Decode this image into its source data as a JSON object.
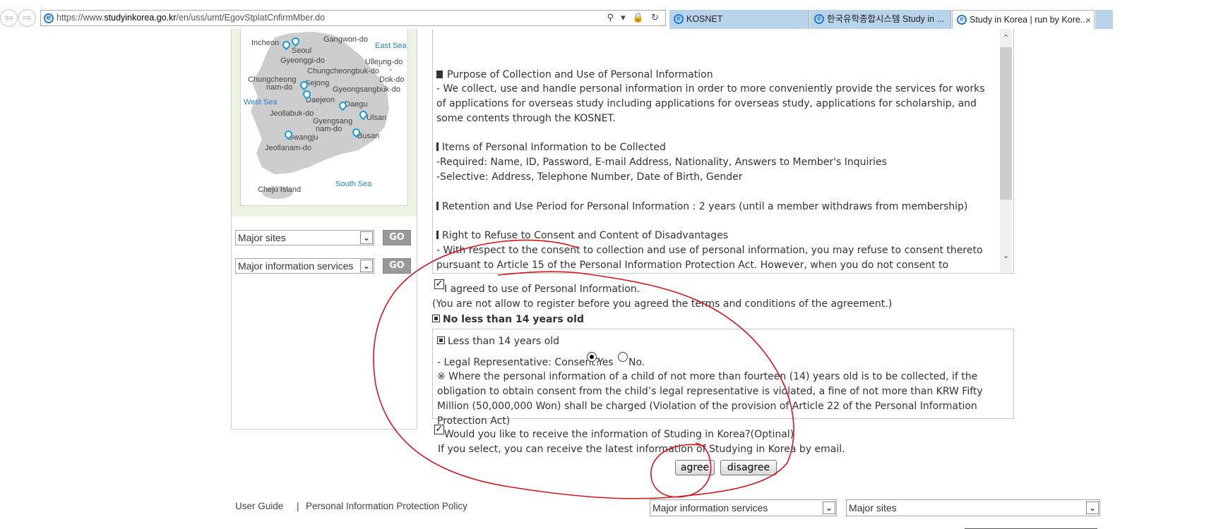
{
  "browser": {
    "url_prefix": "https://www.",
    "url_host": "studyinkorea.go.kr",
    "url_path": "/en/uss/umt/EgovStplatCnfirmMber.do",
    "address_tools": "⚲ ▾ 🔒 ↻",
    "tabs": [
      {
        "label": "KOSNET"
      },
      {
        "label": "한국유학종합시스템 Study in ..."
      },
      {
        "label": "Study in Korea | run by Kore..."
      }
    ],
    "tab_close": "×"
  },
  "map": {
    "labels": {
      "incheon": "Incheon",
      "seoul": "Seoul",
      "gangwon": "Gangwon-do",
      "east_sea": "East Sea",
      "gyeonggi": "Gyeonggi-do",
      "ulleung": "Ulleung-do",
      "chungcheongbuk": "Chungcheongbuk-do",
      "chungcheong_nam1": "Chungcheong",
      "chungcheong_nam2": "nam-do",
      "sejong": "Sejong",
      "dokdo": "Dok-do",
      "gyeongsangbuk": "Gyeongsangbuk-do",
      "west_sea": "West Sea",
      "daejeon": "Daejeon",
      "daegu": "Daegu",
      "jeollabuk": "Jeollabuk-do",
      "ulsan": "Ulsan",
      "gyeongsang_nam1": "Gyengsang",
      "gyeongsang_nam2": "nam-do",
      "gwangju": "Gwangju",
      "busan": "Busan",
      "jeollanam": "Jeollanam-do",
      "cheju": "Cheju Island",
      "south_sea": "South Sea"
    }
  },
  "sidebar": {
    "select1": "Major sites",
    "select2": "Major information services",
    "go_label": "GO"
  },
  "terms": {
    "purpose_heading": "Purpose of Collection and Use of Personal Information",
    "purpose_body": "- We collect, use and handle personal information in order to more conveniently provide the services for works of applications for overseas study including applications for overseas study, applications for scholarship, and some contents through the KOSNET.",
    "items_heading": "Items of Personal Information to be Collected",
    "items_required": "-Required: Name, ID, Password, E-mail Address, Nationality, Answers to Member's Inquiries",
    "items_selective": "-Selective: Address, Telephone Number, Date of Birth, Gender",
    "retention": "Retention and Use Period for Personal Information : 2 years (until a member withdraws from membership)",
    "refuse_heading": "Right to Refuse to Consent and Content of Disadvantages",
    "refuse_body": "- With respect to the consent to collection and use of personal information, you may refuse to consent thereto pursuant to Article 15 of the Personal Information Protection Act. However, when you do not consent to collection and use of"
  },
  "consent": {
    "agree_check": "✓",
    "agree_label": "I agreed to use of Personal Information.",
    "agree_note": "(You are not allow to register before you agreed the terms and conditions of the agreement.)",
    "age_option": "No less than 14 years old",
    "under14_heading": "Less than 14 years old",
    "legal_prefix": "- Legal Representative: Consent?",
    "yes": "Yes",
    "no": "No.",
    "warning": "※ Where the personal information of a child of not more than fourteen (14) years old is to be collected, if the obligation to obtain consent from the child’s legal representative is violated, a fine of not more than KRW Fifty Million (50,000,000 Won) shall be charged (Violation of the provision of Article 22 of the Personal Information Protection Act)",
    "newsletter_check": "✓",
    "newsletter_label": "Would you like to receive the information of Studing in Korea?(Optinal)",
    "newsletter_note": "If you select, you can receive the latest information of Studying in Korea by email.",
    "agree_btn": "agree",
    "disagree_btn": "disagree"
  },
  "footer": {
    "user_guide": "User Guide",
    "separator": "|",
    "privacy": "Personal Information Protection Policy",
    "select_info": "Major information services",
    "select_sites": "Major sites"
  },
  "annotation_color": "#d9141b"
}
